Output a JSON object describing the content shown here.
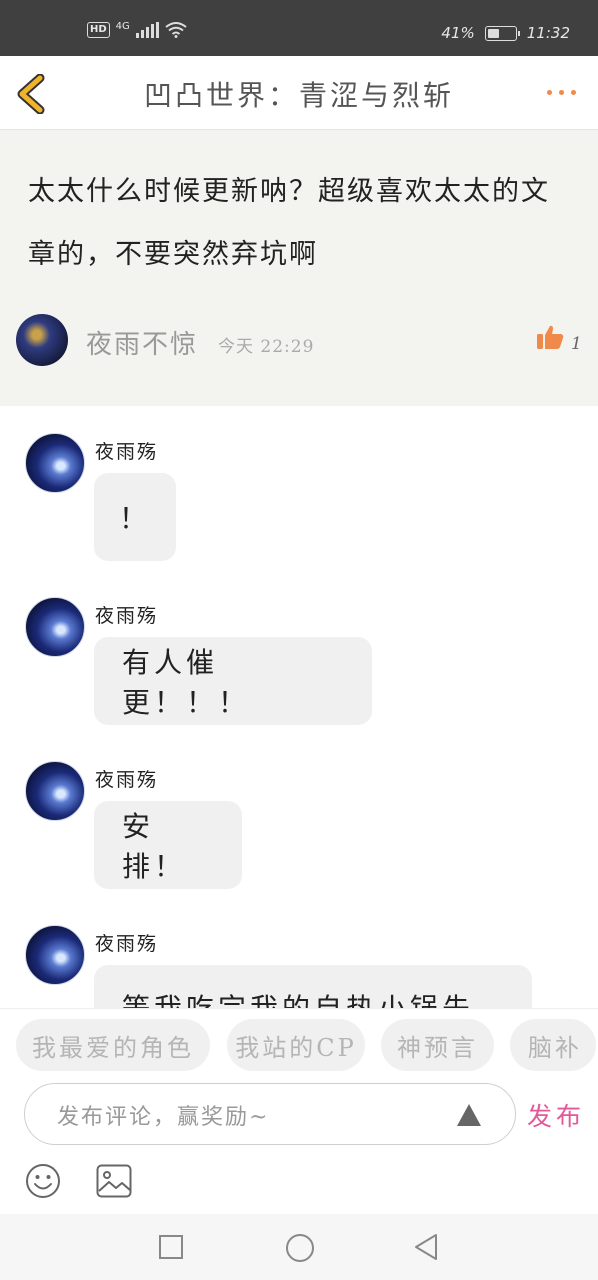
{
  "status_bar": {
    "hd": "HD",
    "network": "4G",
    "battery_percent": "41%",
    "battery_level": 0.41,
    "time": "11:32"
  },
  "header": {
    "back_icon": "chevron-left-icon",
    "title": "凹凸世界：青涩与烈斩",
    "more_icon": "more-dots-icon",
    "accent_color": "#f0b42a"
  },
  "post": {
    "text": "太太什么时候更新呐？超级喜欢太太的文章的，不要突然弃坑啊",
    "author": "夜雨不惊",
    "time": "今天  22:29",
    "like_icon": "thumbs-up-icon",
    "like_count": "1",
    "like_color": "#f08a4b"
  },
  "replies": [
    {
      "name": "夜雨殇",
      "text": "！"
    },
    {
      "name": "夜雨殇",
      "text": "有人催更！！！"
    },
    {
      "name": "夜雨殇",
      "text": "安排！"
    },
    {
      "name": "夜雨殇",
      "text": "等我吃完我的自热小锅先"
    }
  ],
  "tags": [
    "我最爱的角色",
    "我站的CP",
    "神预言",
    "脑补"
  ],
  "input": {
    "placeholder": "发布评论，赢奖励~",
    "publish_label": "发布",
    "publish_color": "#e2599a"
  },
  "toolbar": {
    "emoji_icon": "emoji-icon",
    "image_icon": "image-icon"
  },
  "navbar": {
    "recent_icon": "square-icon",
    "home_icon": "circle-icon",
    "back_icon": "triangle-back-icon"
  }
}
